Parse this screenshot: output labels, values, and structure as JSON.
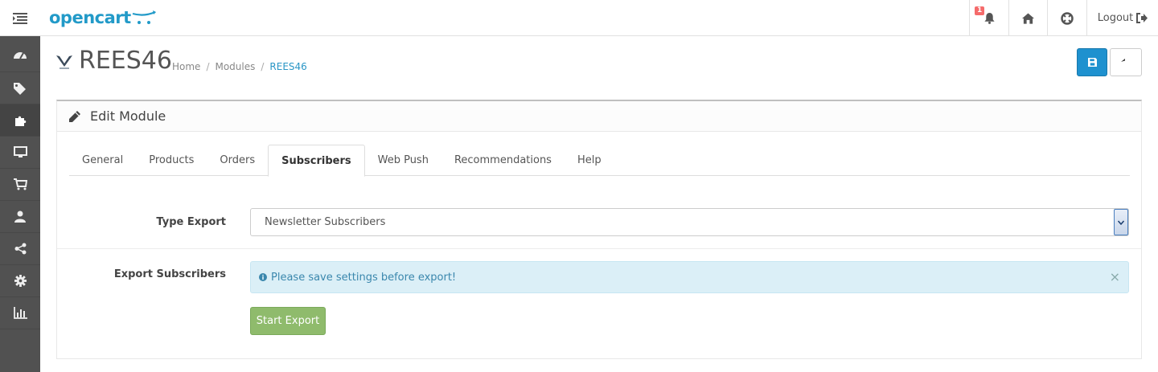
{
  "header": {
    "logo_text": "opencart",
    "notification_count": "1",
    "logout_label": "Logout"
  },
  "sidebar": {
    "items": [
      {
        "icon": "dashboard-icon"
      },
      {
        "icon": "tags-icon"
      },
      {
        "icon": "puzzle-icon",
        "active": true
      },
      {
        "icon": "desktop-icon"
      },
      {
        "icon": "cart-icon"
      },
      {
        "icon": "user-icon"
      },
      {
        "icon": "share-icon"
      },
      {
        "icon": "gear-icon"
      },
      {
        "icon": "bar-chart-icon"
      }
    ]
  },
  "page": {
    "title": "REES46",
    "breadcrumb": [
      "Home",
      "Modules",
      "REES46"
    ]
  },
  "panel": {
    "heading": "Edit Module",
    "tabs": [
      "General",
      "Products",
      "Orders",
      "Subscribers",
      "Web Push",
      "Recommendations",
      "Help"
    ],
    "active_tab": "Subscribers",
    "type_export_label": "Type Export",
    "type_export_value": "Newsletter Subscribers",
    "export_subscribers_label": "Export Subscribers",
    "alert_text": "Please save settings before export!",
    "alert_close": "×",
    "start_export_label": "Start Export"
  },
  "colors": {
    "primary": "#1e91cf",
    "success": "#8fbb6c",
    "info_bg": "#dbeff7",
    "sidebar_bg": "#515151",
    "logo": "#229ac8"
  }
}
